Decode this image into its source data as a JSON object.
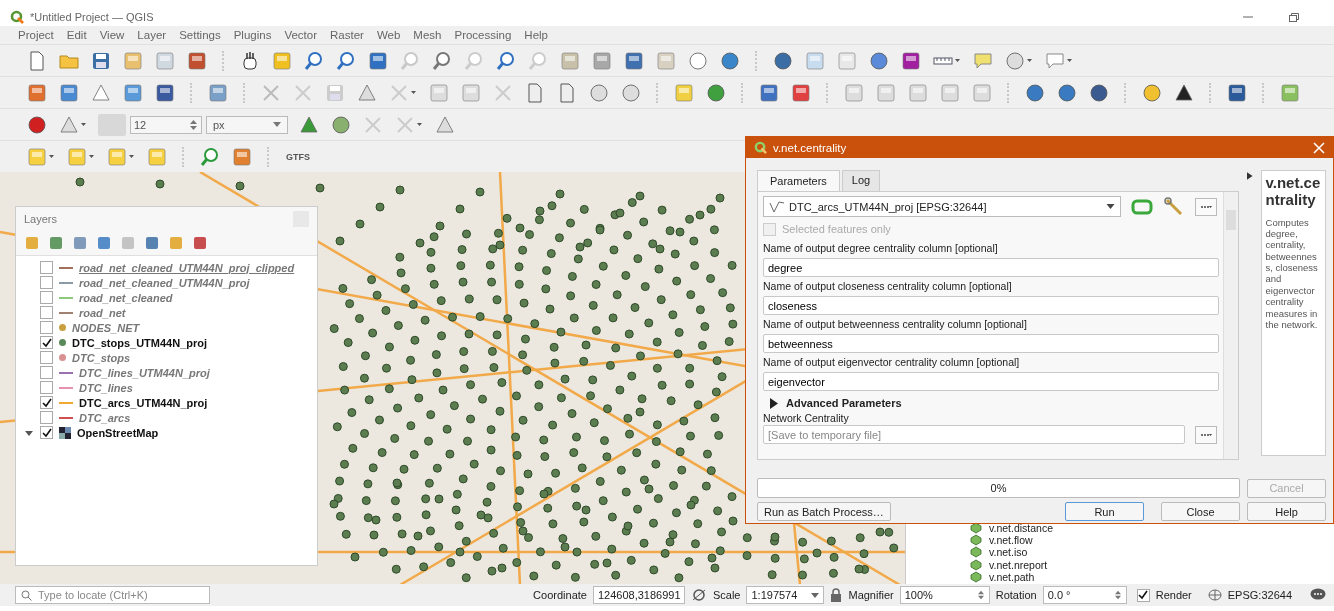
{
  "window": {
    "title": "*Untitled Project — QGIS"
  },
  "menu": [
    "Project",
    "Edit",
    "View",
    "Layer",
    "Settings",
    "Plugins",
    "Vector",
    "Raster",
    "Web",
    "Mesh",
    "Processing",
    "Help"
  ],
  "snapping_toolbar": {
    "tolerance": "12",
    "units": "px"
  },
  "plugin_toolbar": {
    "label": "GTFS"
  },
  "layers_panel": {
    "title": "Layers",
    "layers": [
      {
        "name": "road_net_cleaned_UTM44N_proj_clipped",
        "kind": "line",
        "color": "#a0705a",
        "checked": false,
        "selected": true
      },
      {
        "name": "road_net_cleaned_UTM44N_proj",
        "kind": "line",
        "color": "#8a9aa8",
        "checked": false,
        "selected": false
      },
      {
        "name": "road_net_cleaned",
        "kind": "line",
        "color": "#8cc97a",
        "checked": false,
        "selected": false
      },
      {
        "name": "road_net",
        "kind": "line",
        "color": "#a08070",
        "checked": false,
        "selected": false
      },
      {
        "name": "NODES_NET",
        "kind": "point",
        "color": "#c8a040",
        "checked": false,
        "selected": false
      },
      {
        "name": "DTC_stops_UTM44N_proj",
        "kind": "point",
        "color": "#5a8a5a",
        "checked": true,
        "selected": false
      },
      {
        "name": "DTC_stops",
        "kind": "point",
        "color": "#d89090",
        "checked": false,
        "selected": false
      },
      {
        "name": "DTC_lines_UTM44N_proj",
        "kind": "line",
        "color": "#9a70b0",
        "checked": false,
        "selected": false
      },
      {
        "name": "DTC_lines",
        "kind": "line",
        "color": "#e890b0",
        "checked": false,
        "selected": false
      },
      {
        "name": "DTC_arcs_UTM44N_proj",
        "kind": "line",
        "color": "#f0a830",
        "checked": true,
        "selected": false
      },
      {
        "name": "DTC_arcs",
        "kind": "line",
        "color": "#d05050",
        "checked": false,
        "selected": false
      },
      {
        "name": "OpenStreetMap",
        "kind": "raster",
        "checked": true,
        "selected": false,
        "expanded": true
      }
    ]
  },
  "dialog": {
    "title": "v.net.centrality",
    "tabs": [
      {
        "label": "Parameters",
        "selected": true
      },
      {
        "label": "Log",
        "selected": false
      }
    ],
    "input_layer": "DTC_arcs_UTM44N_proj [EPSG:32644]",
    "selected_only": {
      "label": "Selected features only",
      "checked": false,
      "disabled": true
    },
    "fields": [
      {
        "label": "Name of output degree centrality column [optional]",
        "value": "degree"
      },
      {
        "label": "Name of output closeness centrality column [optional]",
        "value": "closeness"
      },
      {
        "label": "Name of output betweenness centrality column [optional]",
        "value": "betweenness"
      },
      {
        "label": "Name of output eigenvector centrality column [optional]",
        "value": "eigenvector"
      }
    ],
    "advanced": {
      "label": "Advanced Parameters",
      "expanded": false
    },
    "output": {
      "label": "Network Centrality",
      "placeholder": "[Save to temporary file]"
    },
    "help": {
      "title": "v.net.centrality",
      "text": "Computes degree, centrality, betweenness, closeness and eigenvector centrality measures in the network."
    },
    "progress": {
      "level": 0,
      "reading": "0%"
    },
    "cancel_button": {
      "label": "Cancel",
      "disabled": true
    },
    "batch_button": {
      "label": "Run as Batch Process…"
    },
    "buttons": [
      {
        "label": "Run",
        "default": true
      },
      {
        "label": "Close",
        "default": false
      },
      {
        "label": "Help",
        "default": false
      }
    ]
  },
  "processing_list": [
    "v.net.distance",
    "v.net.flow",
    "v.net.iso",
    "v.net.nreport",
    "v.net.path"
  ],
  "status_bar": {
    "locator_placeholder": "Type to locate (Ctrl+K)",
    "coordinate_label": "Coordinate",
    "coordinate": "124608,3186991",
    "scale_label": "Scale",
    "scale": "1:197574",
    "magnifier_label": "Magnifier",
    "magnifier": "100%",
    "rotation_label": "Rotation",
    "rotation": "0.0 °",
    "render": {
      "label": "Render",
      "checked": true
    },
    "crs": "EPSG:32644"
  }
}
